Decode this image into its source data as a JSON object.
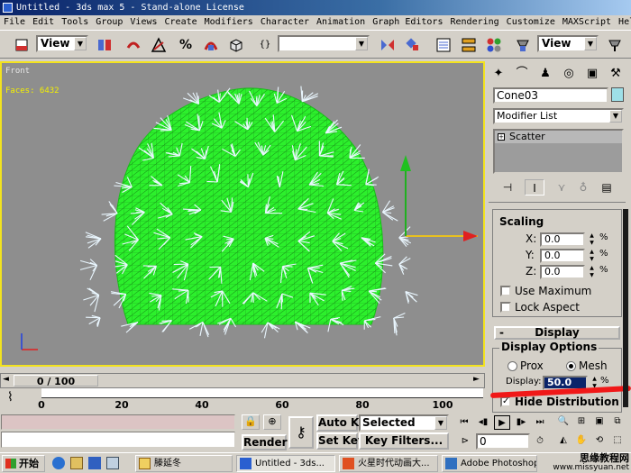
{
  "window": {
    "title": "Untitled - 3ds max 5 - Stand-alone License"
  },
  "menu": [
    "File",
    "Edit",
    "Tools",
    "Group",
    "Views",
    "Create",
    "Modifiers",
    "Character",
    "Animation",
    "Graph Editors",
    "Rendering",
    "Customize",
    "MAXScript",
    "Help"
  ],
  "toolbar": {
    "ref_coord_value": "View",
    "selection_set_value": "",
    "view_combo_value": "View"
  },
  "viewport": {
    "label": "Front",
    "faces_label": "Faces: 6432"
  },
  "command_panel": {
    "object_name": "Cone03",
    "modifier_list_label": "Modifier List",
    "stack_item": "Scatter",
    "stack_toggle": "+",
    "scaling": {
      "title": "Scaling",
      "x_label": "X:",
      "x_value": "0.0",
      "y_label": "Y:",
      "y_value": "0.0",
      "z_label": "Z:",
      "z_value": "0.0",
      "percent": "%",
      "use_maximum": "Use Maximum",
      "lock_aspect": "Lock Aspect"
    },
    "display": {
      "title": "Display",
      "collapse": "-",
      "options_title": "Display Options",
      "proxy": "Prox",
      "mesh": "Mesh",
      "display_label": "Display:",
      "display_value": "50.0",
      "hide_distribution": "Hide Distribution"
    }
  },
  "time_slider": {
    "position": "0 / 100"
  },
  "track_ticks": [
    "0",
    "20",
    "40",
    "60",
    "80",
    "100"
  ],
  "bottom": {
    "auto_key": "Auto Key",
    "set_key": "Set Key",
    "render": "Render",
    "key_mode_value": "Selected",
    "key_filters": "Key Filters...",
    "frame_value": "0"
  },
  "taskbar": {
    "start": "开始",
    "tasks": [
      "滕延冬",
      "Untitled - 3ds...",
      "火星时代动画大...",
      "Adobe Photoshop"
    ],
    "watermark_top": "思缘教程网",
    "watermark_url": "www.missyuan.net"
  },
  "colors": {
    "mesh_green": "#22ff22",
    "spikes": "#e8f6ff",
    "viewport_bg": "#8e8e8e",
    "active_border": "#f3e31e"
  }
}
